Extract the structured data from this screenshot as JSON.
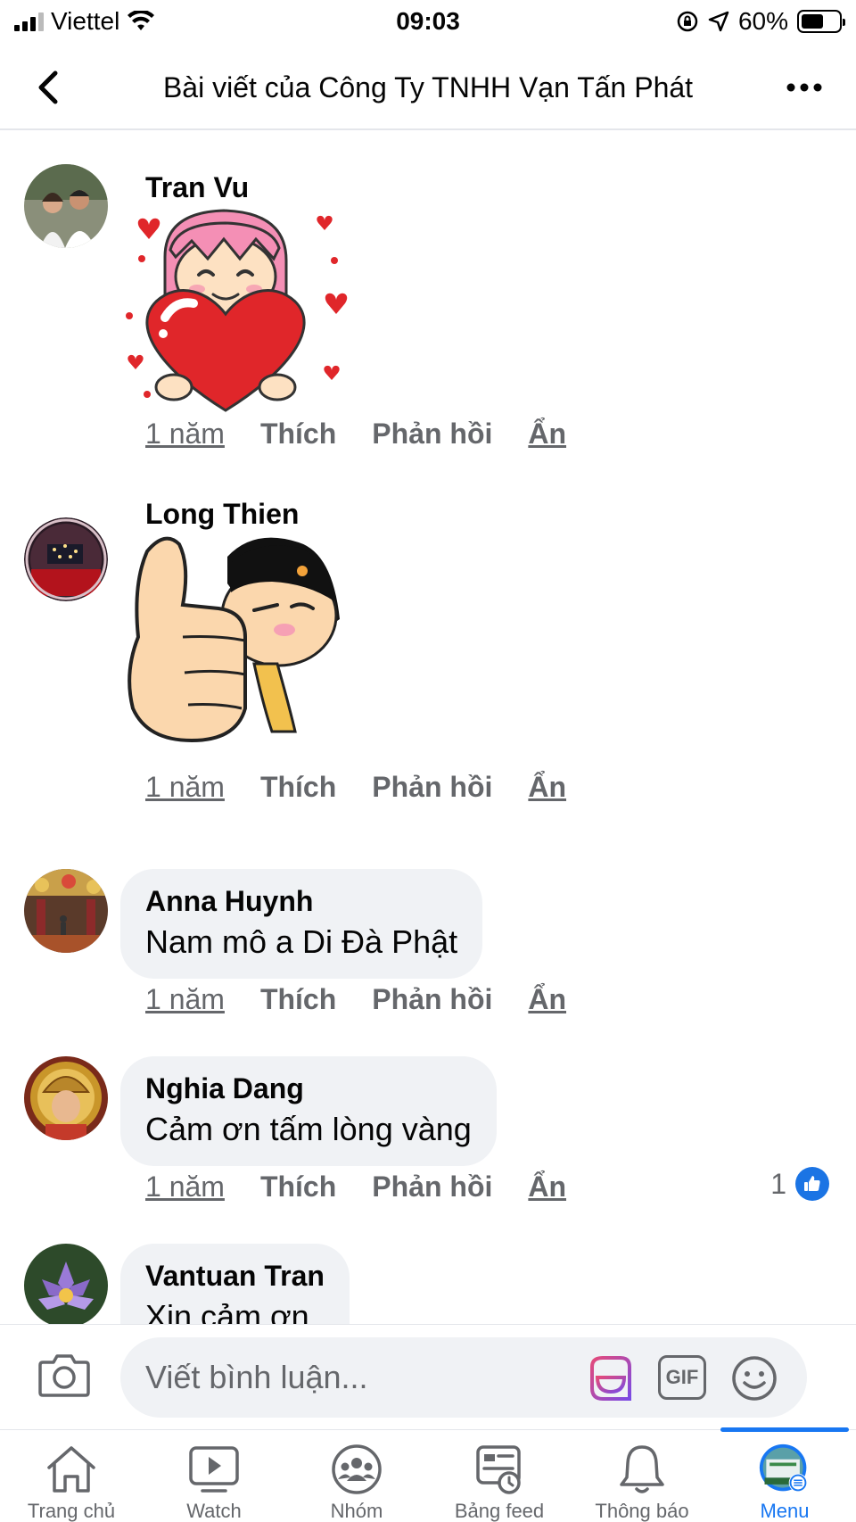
{
  "status_bar": {
    "carrier": "Viettel",
    "time": "09:03",
    "battery": "60%",
    "battery_level": 0.6
  },
  "header": {
    "title": "Bài viết của Công Ty TNHH Vạn Tấn Phát",
    "back_icon": "chevron-left-icon",
    "more_icon": "more-horizontal-icon"
  },
  "comments": [
    {
      "author": "Tran Vu",
      "type": "sticker",
      "sticker": "girl-holding-heart-sticker",
      "time": "1 năm",
      "like_label": "Thích",
      "reply_label": "Phản hồi",
      "hide_label": "Ẩn"
    },
    {
      "author": "Long Thien",
      "type": "sticker",
      "sticker": "thumbs-up-sticker",
      "time": "1 năm",
      "like_label": "Thích",
      "reply_label": "Phản hồi",
      "hide_label": "Ẩn"
    },
    {
      "author": "Anna Huynh",
      "type": "text",
      "text": "Nam mô a Di Đà Phật",
      "time": "1 năm",
      "like_label": "Thích",
      "reply_label": "Phản hồi",
      "hide_label": "Ẩn"
    },
    {
      "author": "Nghia Dang",
      "type": "text",
      "text": "Cảm ơn tấm lòng vàng",
      "time": "1 năm",
      "like_label": "Thích",
      "reply_label": "Phản hồi",
      "hide_label": "Ẩn",
      "reaction_count": "1"
    },
    {
      "author": "Vantuan Tran",
      "type": "text",
      "text": "Xin cảm ơn"
    }
  ],
  "composer": {
    "placeholder": "Viết bình luận...",
    "gif_label": "GIF"
  },
  "bottom_nav": [
    {
      "label": "Trang chủ",
      "icon": "home-icon"
    },
    {
      "label": "Watch",
      "icon": "watch-icon"
    },
    {
      "label": "Nhóm",
      "icon": "groups-icon"
    },
    {
      "label": "Bảng feed",
      "icon": "feeds-icon"
    },
    {
      "label": "Thông báo",
      "icon": "bell-icon"
    },
    {
      "label": "Menu",
      "icon": "menu-avatar-icon",
      "active": true
    }
  ],
  "colors": {
    "accent": "#1877f2",
    "bubble": "#f0f2f5",
    "secondary_text": "#65676b"
  }
}
